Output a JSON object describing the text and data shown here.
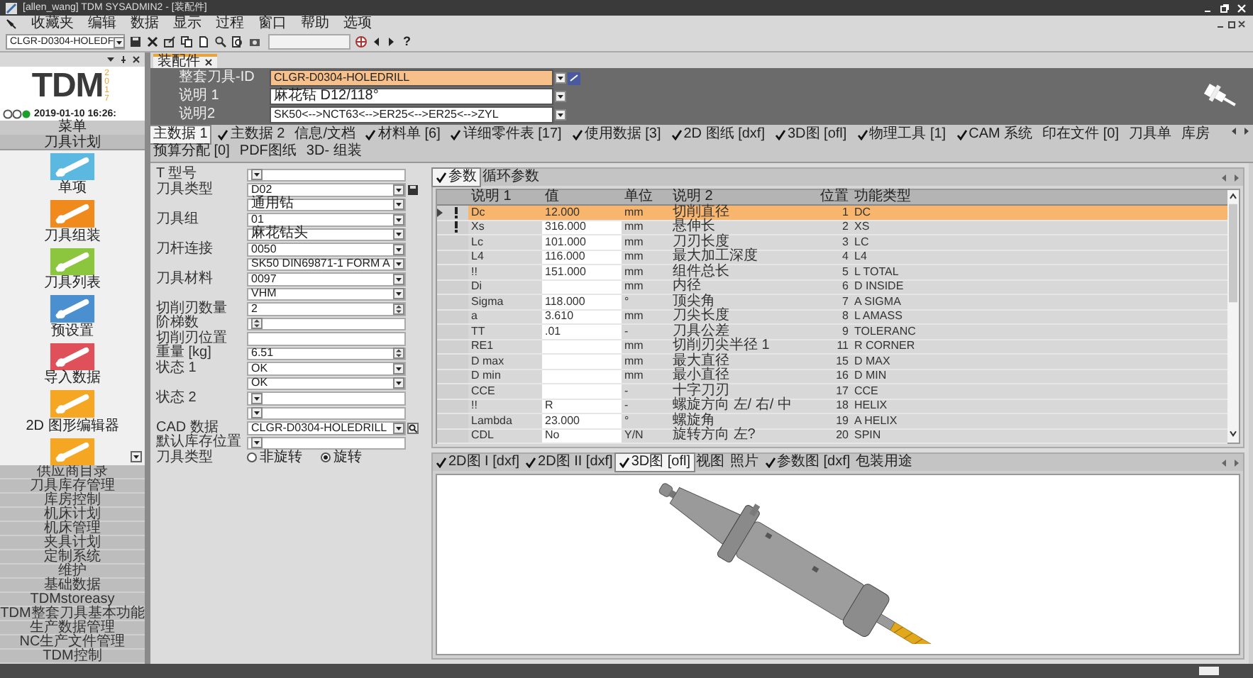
{
  "window": {
    "title": "[allen_wang] TDM SYSADMIN2 - [装配件]"
  },
  "menu": [
    "收藏夹",
    "编辑",
    "数据",
    "显示",
    "过程",
    "窗口",
    "帮助",
    "选项"
  ],
  "toolbar": {
    "tool_id": "CLGR-D0304-HOLEDF",
    "help": "?"
  },
  "sidebar": {
    "logo": "TDM",
    "logo_year": "2017",
    "datetime": "2019-01-10 16:26:",
    "menu_label": "菜单",
    "section": "刀具计划",
    "apps": [
      {
        "label": "单项",
        "color": "#5bb8e0"
      },
      {
        "label": "刀具组装",
        "color": "#f08a1c"
      },
      {
        "label": "刀具列表",
        "color": "#8cc63e"
      },
      {
        "label": "预设置",
        "color": "#4a8fd0"
      },
      {
        "label": "导入数据",
        "color": "#e0505a"
      },
      {
        "label": "2D 图形编辑器",
        "color": "#f5a623"
      },
      {
        "color": "#f5a623"
      }
    ],
    "modules": [
      "供应商目录",
      "刀具库存管理",
      "库房控制",
      "机床计划",
      "机床管理",
      "夹具计划",
      "定制系统",
      "维护",
      "基础数据",
      "TDMstoreasy",
      "TDM整套刀具基本功能",
      "生产数据管理",
      "NC生产文件管理",
      "TDM控制"
    ]
  },
  "document_tab": {
    "label": "装配件"
  },
  "header": {
    "fields": [
      {
        "label": "整套刀具-ID",
        "value": "CLGR-D0304-HOLEDRILL",
        "highlighted": true
      },
      {
        "label": "说明 1",
        "value": "麻花钻 D12/118°",
        "highlighted": false
      },
      {
        "label": "说明2",
        "value": "SK50<-->NCT63<-->ER25<-->ER25<-->ZYL",
        "highlighted": false
      }
    ]
  },
  "tabs": [
    {
      "label": "主数据 1",
      "checked": false,
      "selected": true
    },
    {
      "label": "主数据 2",
      "checked": true,
      "selected": false
    },
    {
      "label": "信息/文档",
      "checked": false,
      "selected": false
    },
    {
      "label": "材料单 [6]",
      "checked": true,
      "selected": false
    },
    {
      "label": "详细零件表 [17]",
      "checked": true,
      "selected": false
    },
    {
      "label": "使用数据 [3]",
      "checked": true,
      "selected": false
    },
    {
      "label": "2D 图纸 [dxf]",
      "checked": true,
      "selected": false
    },
    {
      "label": "3D图 [ofl]",
      "checked": true,
      "selected": false
    },
    {
      "label": "物理工具 [1]",
      "checked": true,
      "selected": false
    },
    {
      "label": "CAM 系统",
      "checked": true,
      "selected": false
    },
    {
      "label": "印在文件 [0]",
      "checked": false,
      "selected": false
    },
    {
      "label": "刀具单",
      "checked": false,
      "selected": false
    },
    {
      "label": "库房",
      "checked": false,
      "selected": false
    },
    {
      "label": "预算分配 [0]",
      "checked": false,
      "selected": false
    },
    {
      "label": "PDF图纸",
      "checked": false,
      "selected": false
    },
    {
      "label": "3D- 组装",
      "checked": false,
      "selected": false
    }
  ],
  "form": {
    "rows": [
      {
        "label": "T 型号",
        "kind": "select"
      },
      {
        "label": "刀具类型",
        "value": "D02",
        "kind": "select-save"
      },
      {
        "value": "通用钻",
        "kind": "select"
      },
      {
        "label": "刀具组",
        "value": "01",
        "kind": "select"
      },
      {
        "value": "麻花钻头",
        "kind": "select"
      },
      {
        "label": "刀杆连接",
        "value": "0050",
        "kind": "select"
      },
      {
        "value": "SK50 DIN69871-1 FORM A",
        "kind": "select"
      },
      {
        "label": "刀具材料",
        "value": "0097",
        "kind": "select"
      },
      {
        "value": "VHM",
        "kind": "select"
      },
      {
        "label": "切削刃数量",
        "value": "2",
        "kind": "spin"
      },
      {
        "label": "阶梯数",
        "kind": "spin"
      },
      {
        "label": "切削刃位置",
        "kind": "text"
      },
      {
        "label": "重量 [kg]",
        "value": "6.51",
        "kind": "spin"
      },
      {
        "label": "状态 1",
        "value": "OK",
        "kind": "select"
      },
      {
        "value": "OK",
        "kind": "select"
      },
      {
        "label": "状态 2",
        "kind": "select"
      },
      {
        "kind": "select"
      },
      {
        "label": "CAD 数据",
        "value": "CLGR-D0304-HOLEDRILL",
        "kind": "select-search"
      },
      {
        "label": "默认库存位置",
        "kind": "select"
      },
      {
        "label": "刀具类型",
        "kind": "radio",
        "options": [
          {
            "label": "非旋转",
            "selected": false
          },
          {
            "label": "旋转",
            "selected": true
          }
        ]
      }
    ]
  },
  "params": {
    "tabs": [
      {
        "label": "参数",
        "checked": true,
        "selected": true
      },
      {
        "label": "循环参数",
        "checked": false,
        "selected": false
      }
    ],
    "columns": [
      "说明 1",
      "值",
      "单位",
      "说明 2",
      "位置",
      "功能类型"
    ],
    "rows": [
      {
        "cells": [
          "Dc",
          "12.000",
          "mm",
          "切削直径",
          "1",
          "DC"
        ],
        "selected": true,
        "flagged": true
      },
      {
        "cells": [
          "Xs",
          "316.000",
          "mm",
          "悬伸长",
          "2",
          "XS"
        ],
        "selected": false,
        "flagged": true
      },
      {
        "cells": [
          "Lc",
          "101.000",
          "mm",
          "刀刃长度",
          "3",
          "LC"
        ],
        "selected": false,
        "flagged": false
      },
      {
        "cells": [
          "L4",
          "116.000",
          "mm",
          "最大加工深度",
          "4",
          "L4"
        ],
        "selected": false,
        "flagged": false
      },
      {
        "cells": [
          "!!",
          "151.000",
          "mm",
          "组件总长",
          "5",
          "L TOTAL"
        ],
        "selected": false,
        "flagged": false
      },
      {
        "cells": [
          "Di",
          null,
          "mm",
          "内径",
          "6",
          "D INSIDE"
        ],
        "selected": false,
        "flagged": false
      },
      {
        "cells": [
          "Sigma",
          "118.000",
          "°",
          "顶尖角",
          "7",
          "A SIGMA"
        ],
        "selected": false,
        "flagged": false
      },
      {
        "cells": [
          "a",
          "3.610",
          "mm",
          "刀尖长度",
          "8",
          "L AMASS"
        ],
        "selected": false,
        "flagged": false
      },
      {
        "cells": [
          "TT",
          ".01",
          "-",
          "刀具公差",
          "9",
          "TOLERANC"
        ],
        "selected": false,
        "flagged": false
      },
      {
        "cells": [
          "RE1",
          null,
          "mm",
          "切削刃尖半径 1",
          "11",
          "R CORNER"
        ],
        "selected": false,
        "flagged": false
      },
      {
        "cells": [
          "D max",
          null,
          "mm",
          "最大直径",
          "15",
          "D MAX"
        ],
        "selected": false,
        "flagged": false
      },
      {
        "cells": [
          "D min",
          null,
          "mm",
          "最小直径",
          "16",
          "D MIN"
        ],
        "selected": false,
        "flagged": false
      },
      {
        "cells": [
          "CCE",
          null,
          "-",
          "十字刀刃",
          "17",
          "CCE"
        ],
        "selected": false,
        "flagged": false
      },
      {
        "cells": [
          "!!",
          "R",
          "-",
          "螺旋方向 左/ 右/ 中",
          "18",
          "HELIX"
        ],
        "selected": false,
        "flagged": false
      },
      {
        "cells": [
          "Lambda",
          "23.000",
          "°",
          "螺旋角",
          "19",
          "A HELIX"
        ],
        "selected": false,
        "flagged": false
      },
      {
        "cells": [
          "CDL",
          "No",
          "Y/N",
          "旋转方向 左?",
          "20",
          "SPIN"
        ],
        "selected": false,
        "flagged": false
      }
    ]
  },
  "view": {
    "tabs": [
      {
        "label": "2D图 I [dxf]",
        "checked": true,
        "selected": false
      },
      {
        "label": "2D图 II [dxf]",
        "checked": true,
        "selected": false
      },
      {
        "label": "3D图 [ofl]",
        "checked": true,
        "selected": true
      },
      {
        "label": "视图",
        "checked": false,
        "selected": false
      },
      {
        "label": "照片",
        "checked": false,
        "selected": false
      },
      {
        "label": "参数图 [dxf]",
        "checked": true,
        "selected": false
      },
      {
        "label": "包装用途",
        "checked": false,
        "selected": false
      }
    ]
  }
}
